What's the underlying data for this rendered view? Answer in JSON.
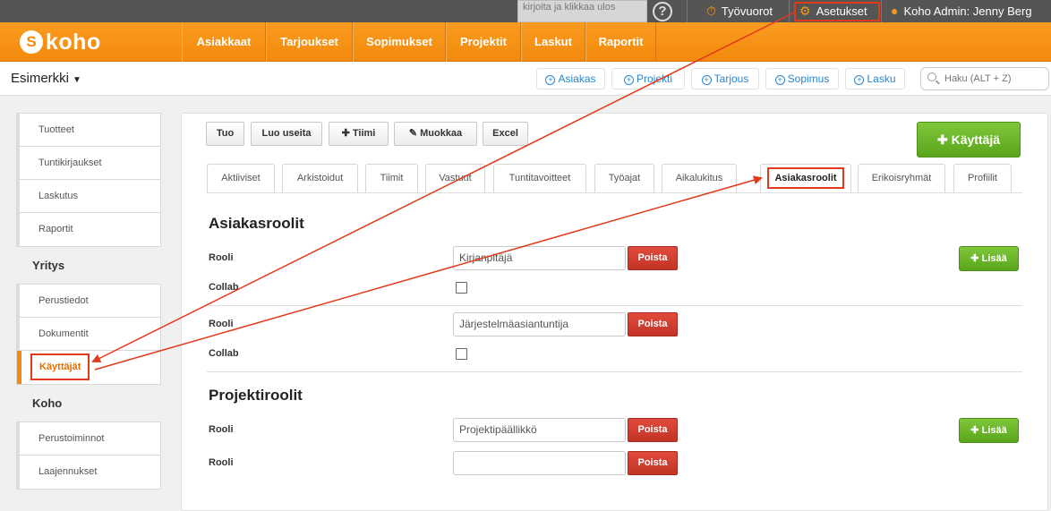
{
  "topbar": {
    "note": "kirjoita ja klikkaa ulos",
    "help": "?",
    "tyovuorot": "Työvuorot",
    "asetukset": "Asetukset",
    "user": "Koho Admin: Jenny Berg"
  },
  "brand": {
    "logo_text": "koho",
    "logo_mark": "S"
  },
  "nav": [
    "Asiakkaat",
    "Tarjoukset",
    "Sopimukset",
    "Projektit",
    "Laskut",
    "Raportit"
  ],
  "context": {
    "company": "Esimerkki",
    "quick_add": [
      "Asiakas",
      "Projekti",
      "Tarjous",
      "Sopimus",
      "Lasku"
    ],
    "search_placeholder": "Haku (ALT + Z)"
  },
  "sidebar": {
    "group1": [
      "Tuotteet",
      "Tuntikirjaukset",
      "Laskutus",
      "Raportit"
    ],
    "heading2": "Yritys",
    "group2": [
      "Perustiedot",
      "Dokumentit",
      "Käyttäjät"
    ],
    "heading3": "Koho",
    "group3": [
      "Perustoiminnot",
      "Laajennukset"
    ]
  },
  "toolbar": [
    "Tuo",
    "Luo useita",
    "Tiimi",
    "Muokkaa",
    "Excel"
  ],
  "add_user_button": "Käyttäjä",
  "tabs": [
    "Aktiiviset",
    "Arkistoidut",
    "Tiimit",
    "Vastuut",
    "Tuntitavoitteet",
    "Työajat",
    "Aikalukitus",
    "Asiakasroolit",
    "Erikoisryhmät",
    "Profiilit"
  ],
  "asiakasroolit": {
    "title": "Asiakasroolit",
    "role_label": "Rooli",
    "collab_label": "Collab",
    "roles": [
      "Kirjanpitäjä",
      "Järjestelmäasiantuntija"
    ],
    "delete": "Poista",
    "add": "Lisää"
  },
  "projektiroolit": {
    "title": "Projektiroolit",
    "role_label": "Rooli",
    "roles": [
      "Projektipäällikkö",
      ""
    ],
    "delete": "Poista",
    "add": "Lisää"
  },
  "colors": {
    "orange": "#f28a0d",
    "green": "#5aa51c",
    "red": "#c23426",
    "annotation": "#e03a1a"
  }
}
